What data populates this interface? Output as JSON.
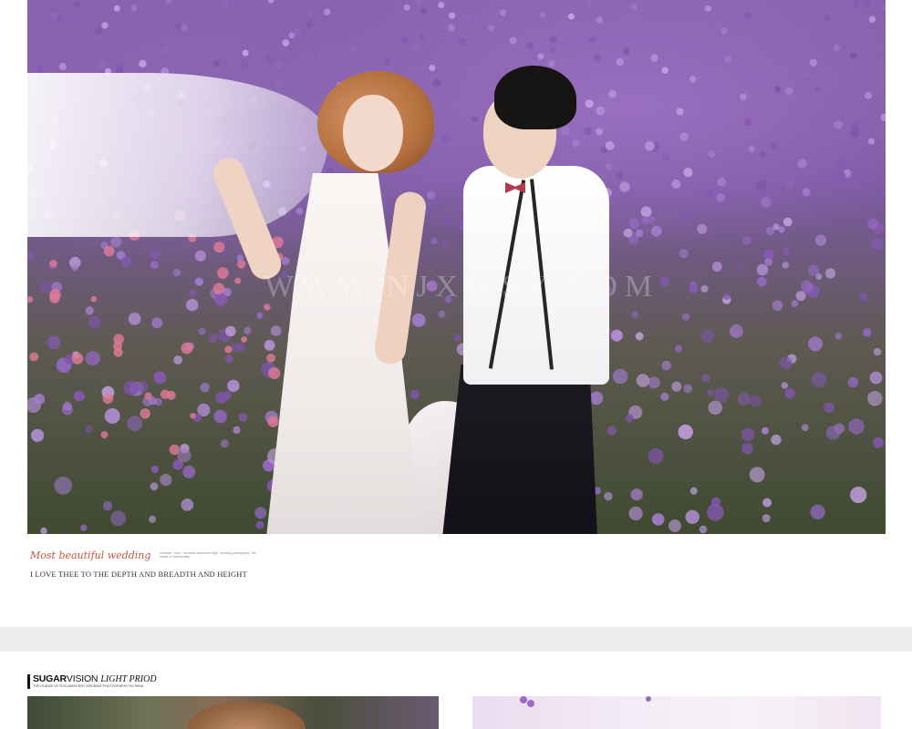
{
  "caption": {
    "script_title": "Most beautiful wedding",
    "fine_print": "romance · story · moments captured in light · wedding photography · the leader of documentary",
    "tagline": "I LOVE THEE TO THE DEPTH AND BREADTH AND HEIGHT"
  },
  "watermark": "WWW.NJXWSY.COM",
  "brand": {
    "strong": "SUGAR",
    "light": "VISION",
    "italic": "LIGHT PRIOD",
    "sub": "THE LEADER OF DOCUMENTARY WEDDING PHOTOGRAPHY IN CHINA"
  },
  "colors": {
    "lavender": "#9a6fc0",
    "caption_accent": "#c4553a",
    "band": "#eeeeee"
  }
}
